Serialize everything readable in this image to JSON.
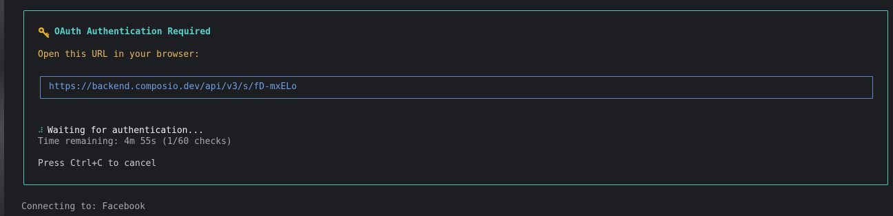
{
  "auth": {
    "title": "OAuth Authentication Required",
    "key_icon": "key-icon",
    "instruction": "Open this URL in your browser:",
    "url": "https://backend.composio.dev/api/v3/s/fD-mxELo",
    "spinner_icon": "spinner-icon",
    "spinner_glyph": "⠼",
    "waiting": "Waiting for authentication...",
    "time_remaining": "Time remaining: 4m 55s (1/60 checks)",
    "cancel_hint": "Press Ctrl+C to cancel"
  },
  "footer": {
    "connecting": "Connecting to: Facebook"
  },
  "colors": {
    "background": "#1d1e21",
    "panel_border": "#4fc7c1",
    "title": "#5ccfc9",
    "instruction": "#e6b85c",
    "url_border": "#5f88c8",
    "url_text": "#6fa0e4",
    "muted_text": "#a6a8ac",
    "bright_text": "#f2f2f2"
  }
}
